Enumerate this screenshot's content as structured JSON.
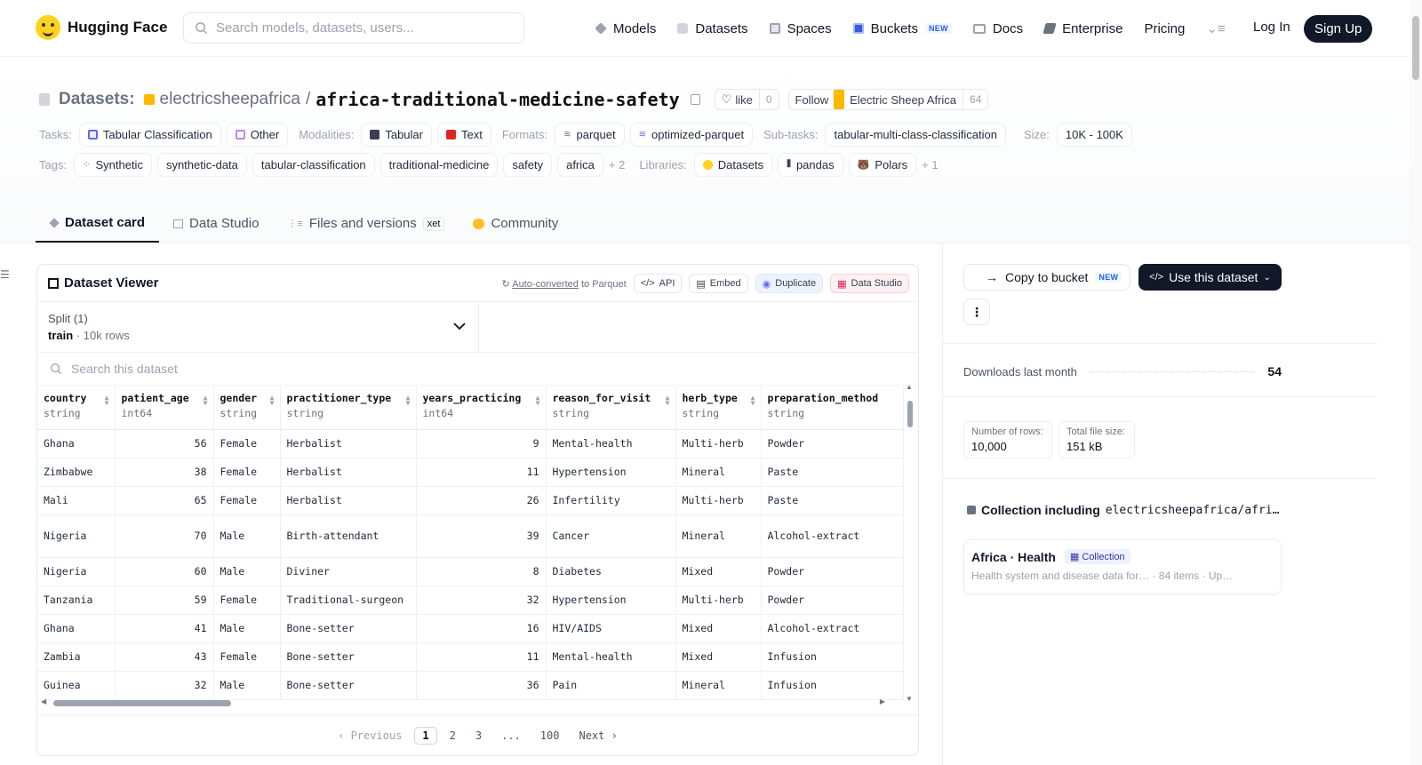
{
  "nav": {
    "brand": "Hugging Face",
    "search_placeholder": "Search models, datasets, users...",
    "links": [
      {
        "label": "Models",
        "icon": "cube-icon"
      },
      {
        "label": "Datasets",
        "icon": "database-icon"
      },
      {
        "label": "Spaces",
        "icon": "grid-icon"
      },
      {
        "label": "Buckets",
        "icon": "bucket-icon",
        "badge": "NEW"
      },
      {
        "label": "Docs",
        "icon": "book-icon"
      },
      {
        "label": "Enterprise",
        "icon": "enterprise-icon"
      },
      {
        "label": "Pricing"
      }
    ],
    "login": "Log In",
    "signup": "Sign Up"
  },
  "header": {
    "section_label": "Datasets:",
    "org": "electricsheepafrica",
    "separator": "/",
    "dataset_name": "africa-traditional-medicine-safety",
    "like_label": "like",
    "like_count": "0",
    "follow_label": "Follow",
    "follow_org": "Electric Sheep Africa",
    "follow_count": "64"
  },
  "tags_row1": {
    "tasks_label": "Tasks:",
    "tasks": [
      "Tabular Classification",
      "Other"
    ],
    "modalities_label": "Modalities:",
    "modalities": [
      "Tabular",
      "Text"
    ],
    "formats_label": "Formats:",
    "formats": [
      "parquet",
      "optimized-parquet"
    ],
    "subtasks_label": "Sub-tasks:",
    "subtasks": [
      "tabular-multi-class-classification"
    ],
    "size_label": "Size:",
    "size": "10K - 100K"
  },
  "tags_row2": {
    "tags_label": "Tags:",
    "tags": [
      "Synthetic",
      "synthetic-data",
      "tabular-classification",
      "traditional-medicine",
      "safety",
      "africa"
    ],
    "tags_more": "+ 2",
    "libraries_label": "Libraries:",
    "libraries": [
      "Datasets",
      "pandas",
      "Polars"
    ],
    "libraries_more": "+ 1"
  },
  "tabs": [
    {
      "label": "Dataset card",
      "active": true
    },
    {
      "label": "Data Studio"
    },
    {
      "label": "Files and versions",
      "badge": "xet"
    },
    {
      "label": "Community"
    }
  ],
  "viewer": {
    "title": "Dataset Viewer",
    "auto_converted": "Auto-converted",
    "to_parquet": " to Parquet",
    "api": "API",
    "embed": "Embed",
    "duplicate": "Duplicate",
    "data_studio": "Data Studio",
    "split_label": "Split (1)",
    "split_name": "train",
    "split_rows": "10k rows",
    "search_placeholder": "Search this dataset",
    "columns": [
      {
        "name": "country",
        "type": "string"
      },
      {
        "name": "patient_age",
        "type": "int64"
      },
      {
        "name": "gender",
        "type": "string"
      },
      {
        "name": "practitioner_type",
        "type": "string"
      },
      {
        "name": "years_practicing",
        "type": "int64"
      },
      {
        "name": "reason_for_visit",
        "type": "string"
      },
      {
        "name": "herb_type",
        "type": "string"
      },
      {
        "name": "preparation_method",
        "type": "string"
      }
    ],
    "rows": [
      [
        "Ghana",
        "56",
        "Female",
        "Herbalist",
        "9",
        "Mental-health",
        "Multi-herb",
        "Powder"
      ],
      [
        "Zimbabwe",
        "38",
        "Female",
        "Herbalist",
        "11",
        "Hypertension",
        "Mineral",
        "Paste"
      ],
      [
        "Mali",
        "65",
        "Female",
        "Herbalist",
        "26",
        "Infertility",
        "Multi-herb",
        "Paste"
      ],
      [
        "Nigeria",
        "70",
        "Male",
        "Birth-attendant",
        "39",
        "Cancer",
        "Mineral",
        "Alcohol-extract"
      ],
      [
        "Nigeria",
        "60",
        "Male",
        "Diviner",
        "8",
        "Diabetes",
        "Mixed",
        "Powder"
      ],
      [
        "Tanzania",
        "59",
        "Female",
        "Traditional-surgeon",
        "32",
        "Hypertension",
        "Multi-herb",
        "Powder"
      ],
      [
        "Ghana",
        "41",
        "Male",
        "Bone-setter",
        "16",
        "HIV/AIDS",
        "Mixed",
        "Alcohol-extract"
      ],
      [
        "Zambia",
        "43",
        "Female",
        "Bone-setter",
        "11",
        "Mental-health",
        "Mixed",
        "Infusion"
      ],
      [
        "Guinea",
        "32",
        "Male",
        "Bone-setter",
        "36",
        "Pain",
        "Mineral",
        "Infusion"
      ]
    ],
    "pager": {
      "prev": "Previous",
      "pages": [
        "1",
        "2",
        "3",
        "...",
        "100"
      ],
      "current": "1",
      "next": "Next"
    }
  },
  "sidebar": {
    "copy_bucket": "Copy to bucket",
    "copy_badge": "NEW",
    "use_dataset": "Use this dataset",
    "downloads_label": "Downloads last month",
    "downloads_value": "54",
    "rows_label": "Number of rows:",
    "rows_value": "10,000",
    "size_label": "Total file size:",
    "size_value": "151 kB",
    "collection_label": "Collection including",
    "collection_path": "electricsheepafrica/afri…",
    "collection_name": "Africa · Health",
    "collection_badge": "Collection",
    "collection_desc": "Health system and disease data for…",
    "collection_items": "· 84 items",
    "collection_updated": "· Up…"
  }
}
